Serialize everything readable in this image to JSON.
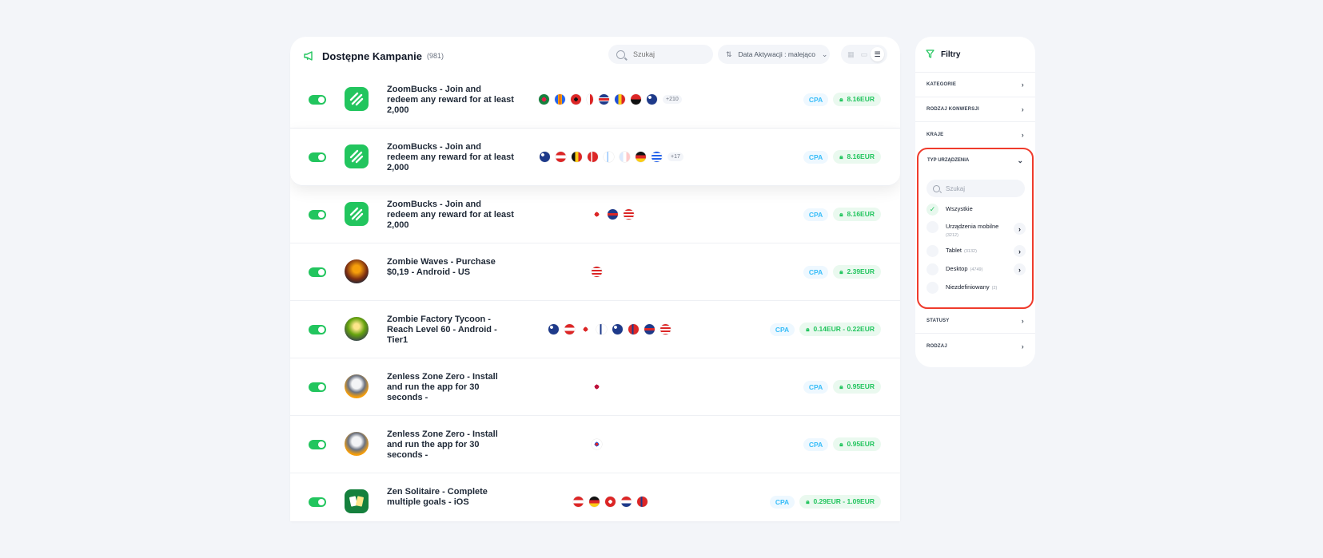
{
  "header": {
    "title": "Dostępne Kampanie",
    "count": "(981)",
    "search_placeholder": "Szukaj",
    "sort_label": "Data Aktywacji : malejąco"
  },
  "campaigns": [
    {
      "name": "ZoomBucks - Join and redeem any reward for at least 2,000",
      "more": "+210",
      "type": "CPA",
      "price": "8.16EUR"
    },
    {
      "name": "ZoomBucks - Join and redeem any reward for at least 2,000",
      "more": "+17",
      "type": "CPA",
      "price": "8.16EUR"
    },
    {
      "name": "ZoomBucks - Join and redeem any reward for at least 2,000",
      "more": "",
      "type": "CPA",
      "price": "8.16EUR"
    },
    {
      "name": "Zombie Waves - Purchase $0,19 - Android - US",
      "more": "",
      "type": "CPA",
      "price": "2.39EUR"
    },
    {
      "name": "Zombie Factory Tycoon - Reach Level 60 - Android - Tier1",
      "more": "",
      "type": "CPA",
      "price": "0.14EUR - 0.22EUR"
    },
    {
      "name": "Zenless Zone Zero - Install and run the app for 30 seconds -",
      "more": "",
      "type": "CPA",
      "price": "0.95EUR"
    },
    {
      "name": "Zenless Zone Zero - Install and run the app for 30 seconds -",
      "more": "",
      "type": "CPA",
      "price": "0.95EUR"
    },
    {
      "name": "Zen Solitaire - Complete multiple goals - iOS",
      "more": "",
      "type": "CPA",
      "price": "0.29EUR - 1.09EUR"
    }
  ],
  "filters": {
    "title": "Filtry",
    "sections": [
      "KATEGORIE",
      "RODZAJ KONWERSJI",
      "KRAJE"
    ],
    "device": {
      "title": "TYP URZĄDZENIA",
      "search_placeholder": "Szukaj",
      "options": [
        {
          "label": "Wszystkie",
          "count": ""
        },
        {
          "label": "Urządzenia mobilne",
          "count": "(3212)"
        },
        {
          "label": "Tablet",
          "count": "(3132)"
        },
        {
          "label": "Desktop",
          "count": "(4749)"
        },
        {
          "label": "Niezdefiniowany",
          "count": "(2)"
        }
      ]
    },
    "bottom_sections": [
      "STATUSY",
      "RODZAJ"
    ]
  },
  "colors": {
    "accent": "#22c55e",
    "cpa": "#38bdf8",
    "highlight": "#ef3b2c"
  }
}
